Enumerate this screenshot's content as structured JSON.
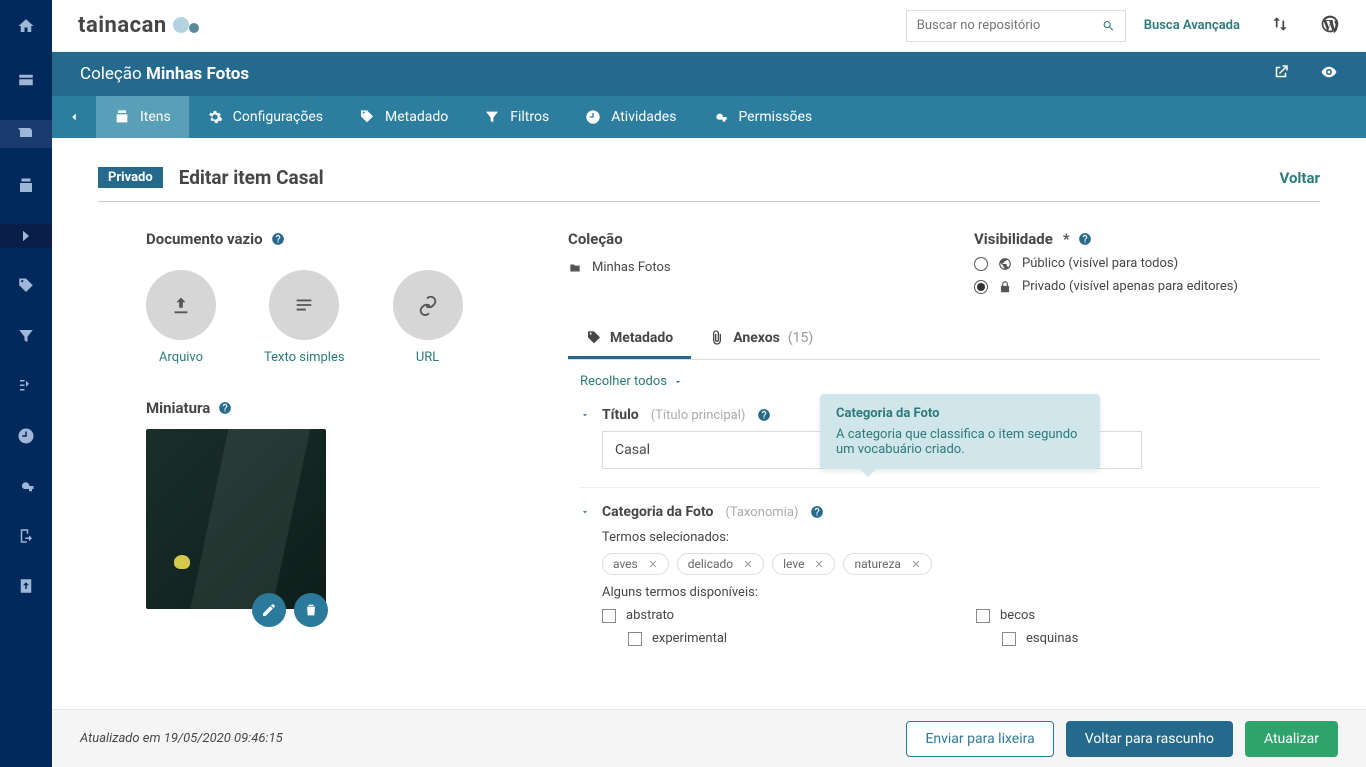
{
  "brand": "TaInacan",
  "search": {
    "placeholder": "Buscar no repositório"
  },
  "advancedSearch": "Busca Avançada",
  "collectionHeader": {
    "prefix": "Coleção",
    "name": "Minhas Fotos"
  },
  "tabs": {
    "items": "Itens",
    "settings": "Configurações",
    "metadata": "Metadado",
    "filters": "Filtros",
    "activities": "Atividades",
    "permissions": "Permissões"
  },
  "page": {
    "badge": "Privado",
    "titlePrefix": "Editar item",
    "itemName": "Casal",
    "back": "Voltar"
  },
  "document": {
    "label": "Documento vazio",
    "file": "Arquivo",
    "text": "Texto simples",
    "url": "URL"
  },
  "thumbnail": {
    "label": "Miniatura"
  },
  "collection": {
    "label": "Coleção",
    "value": "Minhas Fotos"
  },
  "visibility": {
    "label": "Visibilidade",
    "public": "Público (visível para todos)",
    "private": "Privado (visível apenas para editores)"
  },
  "metaTabs": {
    "metadata": "Metadado",
    "attachments": "Anexos",
    "attachmentsCount": "(15)"
  },
  "collapseAll": "Recolher todos",
  "fields": {
    "title": {
      "label": "Título",
      "sub": "(Título principal)",
      "value": "Casal"
    },
    "category": {
      "label": "Categoria da Foto",
      "sub": "(Taxonomia)",
      "selectedLabel": "Termos selecionados:",
      "tags": [
        "aves",
        "delicado",
        "leve",
        "natureza"
      ],
      "availableLabel": "Alguns termos disponíveis:",
      "terms": {
        "abstrato": "abstrato",
        "experimental": "experimental",
        "becos": "becos",
        "esquinas": "esquinas"
      }
    }
  },
  "tooltip": {
    "title": "Categoria da Foto",
    "body": "A categoria que classifica o item segundo um vocabuário criado."
  },
  "footer": {
    "updated": "Atualizado em 19/05/2020 09:46:15",
    "trash": "Enviar para lixeira",
    "draft": "Voltar para rascunho",
    "update": "Atualizar"
  }
}
